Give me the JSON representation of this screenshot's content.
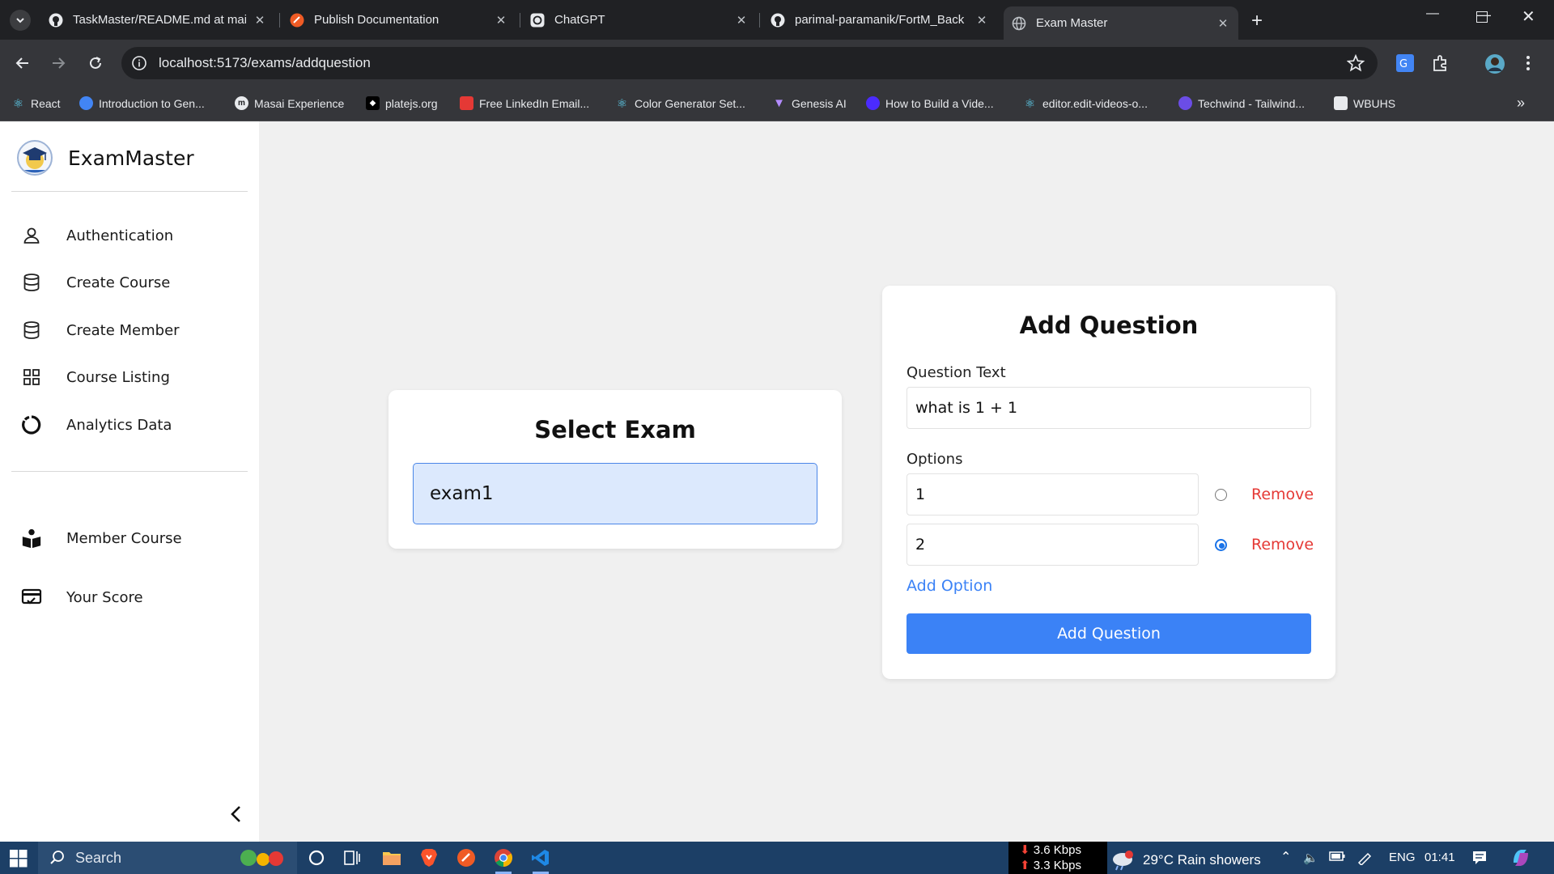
{
  "browser": {
    "tabs": [
      {
        "title": "TaskMaster/README.md at mai",
        "favicon": "github-icon"
      },
      {
        "title": "Publish Documentation",
        "favicon": "postman-icon"
      },
      {
        "title": "ChatGPT",
        "favicon": "chatgpt-icon"
      },
      {
        "title": "parimal-paramanik/FortM_Back",
        "favicon": "github-icon"
      },
      {
        "title": "Exam Master",
        "favicon": "globe-icon",
        "active": true
      }
    ],
    "url": "localhost:5173/exams/addquestion",
    "bookmarks": [
      {
        "label": "React",
        "icon": "react-icon"
      },
      {
        "label": "Introduction to Gen...",
        "icon": "google-cloud-icon"
      },
      {
        "label": "Masai Experience",
        "icon": "masai-icon"
      },
      {
        "label": "platejs.org",
        "icon": "plate-icon"
      },
      {
        "label": "Free LinkedIn Email...",
        "icon": "linkedin-finder-icon"
      },
      {
        "label": "Color Generator Set...",
        "icon": "color-icon"
      },
      {
        "label": "Genesis AI",
        "icon": "genesis-icon"
      },
      {
        "label": "How to Build a Vide...",
        "icon": "circle-icon"
      },
      {
        "label": "editor.edit-videos-o...",
        "icon": "react-icon"
      },
      {
        "label": "Techwind - Tailwind...",
        "icon": "techwind-icon"
      },
      {
        "label": "WBUHS",
        "icon": "doc-icon"
      }
    ]
  },
  "app": {
    "brand": "ExamMaster",
    "nav": [
      {
        "label": "Authentication",
        "icon": "user-icon"
      },
      {
        "label": "Create Course",
        "icon": "database-icon"
      },
      {
        "label": "Create Member",
        "icon": "database-icon"
      },
      {
        "label": "Course Listing",
        "icon": "grid-icon"
      },
      {
        "label": "Analytics Data",
        "icon": "pie-icon"
      }
    ],
    "nav2": [
      {
        "label": "Member Course",
        "icon": "reader-icon"
      },
      {
        "label": "Your Score",
        "icon": "score-card-icon"
      }
    ],
    "select_exam": {
      "title": "Select Exam",
      "value": "exam1"
    },
    "add_question": {
      "title": "Add Question",
      "question_label": "Question Text",
      "question_value": "what is 1 + 1",
      "options_label": "Options",
      "options": [
        {
          "value": "1",
          "selected": false,
          "remove_label": "Remove"
        },
        {
          "value": "2",
          "selected": true,
          "remove_label": "Remove"
        }
      ],
      "add_option_label": "Add Option",
      "submit_label": "Add Question"
    }
  },
  "taskbar": {
    "search_placeholder": "Search",
    "net_down": "3.6 Kbps",
    "net_up": "3.3 Kbps",
    "weather": "29°C  Rain showers",
    "language": "ENG",
    "time": "01:41"
  },
  "colors": {
    "accent": "#3b82f6",
    "danger": "#e53935",
    "select_bg": "#dce9fd"
  }
}
